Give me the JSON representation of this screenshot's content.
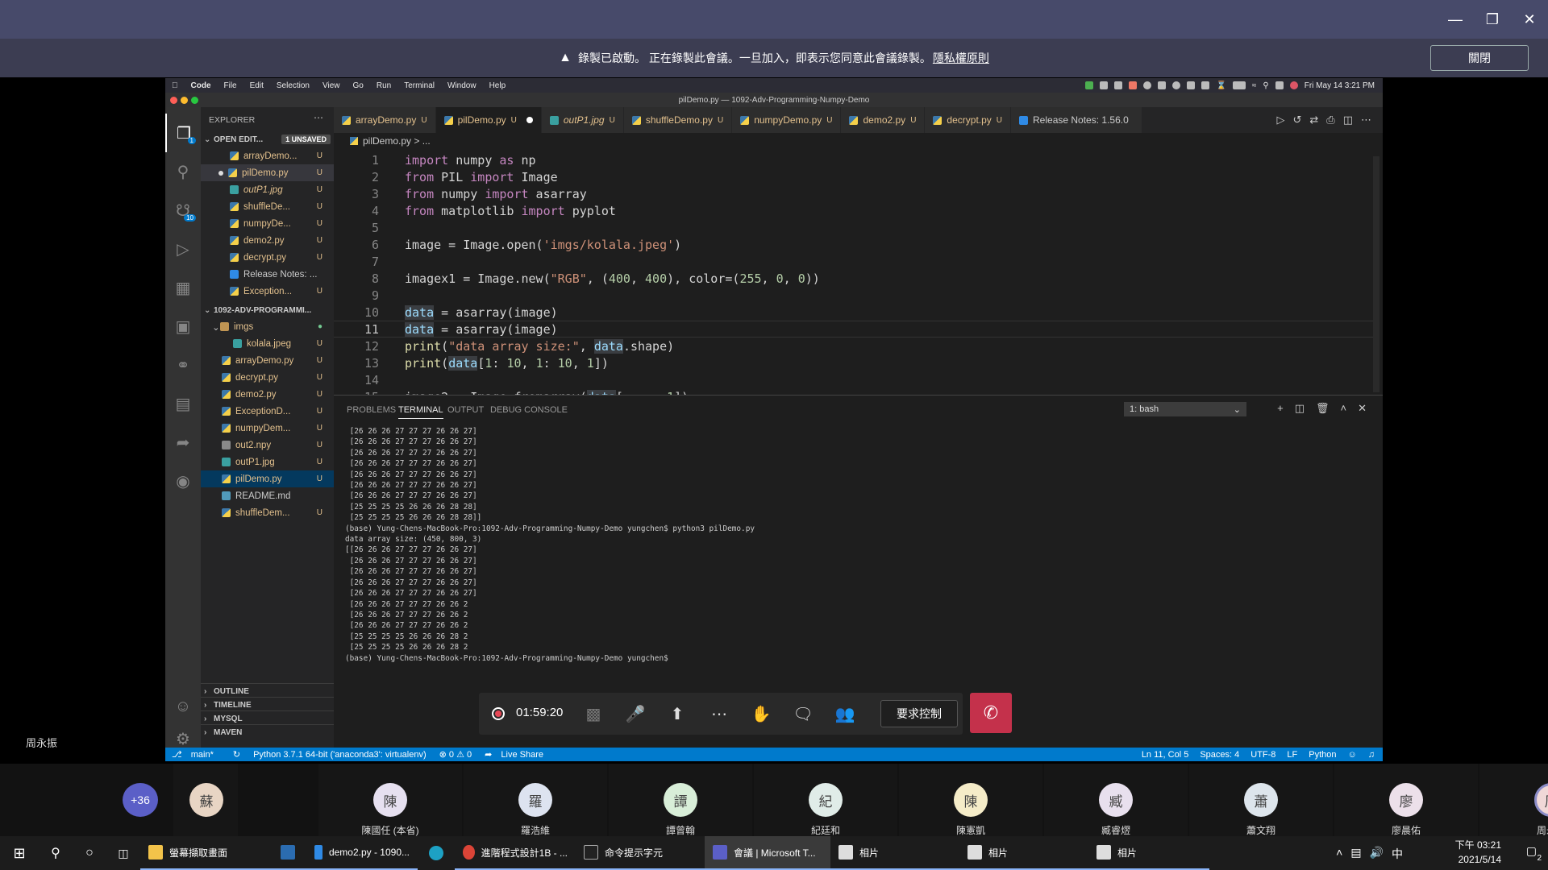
{
  "teams": {
    "banner_text": "錄製已啟動。 正在錄製此會議。一旦加入，即表示您同意此會議錄製。",
    "banner_link": "隱私權原則",
    "close_label": "關閉",
    "left_name": "周永振",
    "timer": "01:59:20",
    "request_control": "要求控制",
    "more_count": "+36"
  },
  "mac": {
    "menu": [
      "Code",
      "File",
      "Edit",
      "Selection",
      "View",
      "Go",
      "Run",
      "Terminal",
      "Window",
      "Help"
    ],
    "datetime": "Fri May 14  3:21 PM",
    "window_title": "pilDemo.py — 1092-Adv-Programming-Numpy-Demo"
  },
  "vscode": {
    "explorer_title": "EXPLORER",
    "open_editors": "OPEN EDIT...",
    "unsaved_badge": "1 UNSAVED",
    "project": "1092-ADV-PROGRAMMI...",
    "scm_badge": "10",
    "settings_badge": "1",
    "open_files": [
      {
        "name": "arrayDemo...",
        "t": "py",
        "u": "U"
      },
      {
        "name": "pilDemo.py",
        "t": "py",
        "u": "U"
      },
      {
        "name": "outP1.jpg",
        "t": "img",
        "u": "U"
      },
      {
        "name": "shuffleDe...",
        "t": "py",
        "u": "U"
      },
      {
        "name": "numpyDe...",
        "t": "py",
        "u": "U"
      },
      {
        "name": "demo2.py",
        "t": "py",
        "u": "U"
      },
      {
        "name": "decrypt.py",
        "t": "py",
        "u": "U"
      },
      {
        "name": "Release Notes: ...",
        "t": "vs",
        "u": ""
      },
      {
        "name": "Exception...",
        "t": "py",
        "u": "U"
      }
    ],
    "folder_img": "imgs",
    "tree_files": [
      {
        "name": "kolala.jpeg",
        "t": "img",
        "u": "U"
      },
      {
        "name": "arrayDemo.py",
        "t": "py",
        "u": "U"
      },
      {
        "name": "decrypt.py",
        "t": "py",
        "u": "U"
      },
      {
        "name": "demo2.py",
        "t": "py",
        "u": "U"
      },
      {
        "name": "ExceptionD...",
        "t": "py",
        "u": "U"
      },
      {
        "name": "numpyDem...",
        "t": "py",
        "u": "U"
      },
      {
        "name": "out2.npy",
        "t": "np",
        "u": "U"
      },
      {
        "name": "outP1.jpg",
        "t": "img",
        "u": "U"
      },
      {
        "name": "pilDemo.py",
        "t": "py",
        "u": "U"
      },
      {
        "name": "README.md",
        "t": "md",
        "u": ""
      },
      {
        "name": "shuffleDem...",
        "t": "py",
        "u": "U"
      }
    ],
    "bottom_sections": [
      "OUTLINE",
      "TIMELINE",
      "MYSQL",
      "MAVEN"
    ],
    "tabs": [
      {
        "name": "arrayDemo.py",
        "t": "py",
        "status": "U"
      },
      {
        "name": "pilDemo.py",
        "t": "py",
        "status": "U"
      },
      {
        "name": "outP1.jpg",
        "t": "img",
        "status": "U"
      },
      {
        "name": "shuffleDemo.py",
        "t": "py",
        "status": "U"
      },
      {
        "name": "numpyDemo.py",
        "t": "py",
        "status": "U"
      },
      {
        "name": "demo2.py",
        "t": "py",
        "status": "U"
      },
      {
        "name": "decrypt.py",
        "t": "py",
        "status": "U"
      },
      {
        "name": "Release Notes: 1.56.0",
        "t": "vs",
        "status": ""
      }
    ],
    "breadcrumb": "pilDemo.py  >  ...",
    "tooltip": "data",
    "panel_tabs": [
      "PROBLEMS",
      "TERMINAL",
      "OUTPUT",
      "DEBUG CONSOLE"
    ],
    "bash_select": "1: bash",
    "terminal": " [26 26 26 27 27 27 26 26 27]\n [26 26 26 27 27 27 26 26 27]\n [26 26 26 27 27 27 26 26 27]\n [26 26 26 27 27 27 26 26 27]\n [26 26 26 27 27 27 26 26 27]\n [26 26 26 27 27 27 26 26 27]\n [26 26 26 27 27 27 26 26 27]\n [25 25 25 25 26 26 26 28 28]\n [25 25 25 25 26 26 26 28 28]]\n(base) Yung-Chens-MacBook-Pro:1092-Adv-Programming-Numpy-Demo yungchen$ python3 pilDemo.py\ndata array size: (450, 800, 3)\n[[26 26 26 27 27 27 26 26 27]\n [26 26 26 27 27 27 26 26 27]\n [26 26 26 27 27 27 26 26 27]\n [26 26 26 27 27 27 26 26 27]\n [26 26 26 27 27 27 26 26 27]\n [26 26 26 27 27 27 26 26 2\n [26 26 26 27 27 27 26 26 2\n [26 26 26 27 27 27 26 26 2\n [25 25 25 25 26 26 26 28 2\n [25 25 25 25 26 26 26 28 2\n(base) Yung-Chens-MacBook-Pro:1092-Adv-Programming-Numpy-Demo yungchen$ ",
    "status": {
      "branch": "main*",
      "interpreter": "Python 3.7.1 64-bit ('anaconda3': virtualenv)",
      "problems": "⊗ 0 ⚠ 0",
      "liveshare": "Live Share",
      "position": "Ln 11, Col 5",
      "spaces": "Spaces: 4",
      "encoding": "UTF-8",
      "eol": "LF",
      "lang": "Python"
    }
  },
  "participants": [
    {
      "initial": "蘇",
      "name": "",
      "color": "#e8d5c4"
    },
    {
      "initial": "陳",
      "name": "陳國任 (本省)",
      "color": "#e6e0f0"
    },
    {
      "initial": "羅",
      "name": "羅浩維",
      "color": "#dde3f0"
    },
    {
      "initial": "譚",
      "name": "譚曾翰",
      "color": "#d8eed8"
    },
    {
      "initial": "紀",
      "name": "紀廷和",
      "color": "#e0ece8"
    },
    {
      "initial": "陳",
      "name": "陳憲凱",
      "color": "#f5ecc8"
    },
    {
      "initial": "臧",
      "name": "臧睿熤",
      "color": "#e8e0ee"
    },
    {
      "initial": "蕭",
      "name": "蕭文翔",
      "color": "#dde5ec"
    },
    {
      "initial": "廖",
      "name": "廖晨佑",
      "color": "#ece0ea"
    },
    {
      "initial": "周",
      "name": "周永振",
      "color": "#f0d8d8"
    }
  ],
  "taskbar": {
    "items": [
      "螢幕擷取畫面",
      "",
      "demo2.py - 1090...",
      "",
      "進階程式設計1B - ...",
      "命令提示字元",
      "會議 | Microsoft T...",
      "相片",
      "相片",
      "相片"
    ],
    "time": "下午 03:21",
    "date": "2021/5/14",
    "ime": "中",
    "notif": "2"
  }
}
